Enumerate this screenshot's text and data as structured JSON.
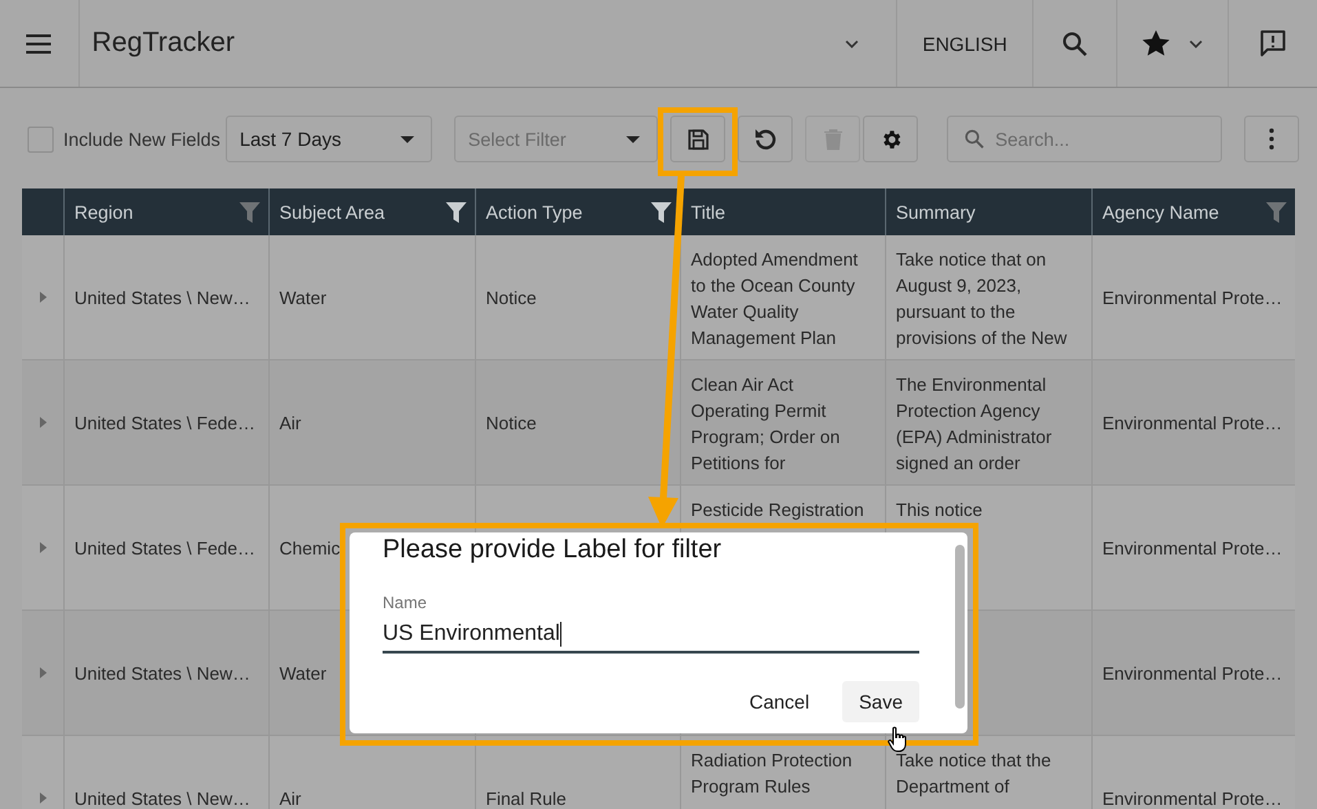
{
  "app": {
    "title": "RegTracker",
    "language": "ENGLISH"
  },
  "toolbar": {
    "include_new_fields": {
      "label": "Include New Fields",
      "checked": false
    },
    "date_range": "Last 7 Days",
    "filter": {
      "placeholder": "Select Filter"
    },
    "delete_button": {
      "disabled": true
    },
    "search": {
      "placeholder": "Search..."
    }
  },
  "table": {
    "columns": [
      {
        "label": "Region",
        "filter": true,
        "filter_active": false
      },
      {
        "label": "Subject Area",
        "filter": true,
        "filter_active": true
      },
      {
        "label": "Action Type",
        "filter": true,
        "filter_active": true
      },
      {
        "label": "Title",
        "filter": false
      },
      {
        "label": "Summary",
        "filter": false
      },
      {
        "label": "Agency Name",
        "filter": true,
        "filter_active": false
      }
    ],
    "rows": [
      {
        "region": "United States \\ New…",
        "subject_area": "Water",
        "action_type": "Notice",
        "title": "Adopted Amendment to the Ocean County Water Quality Management Plan",
        "summary": "Take notice that on August 9, 2023, pursuant to the provisions of the New",
        "agency_name": "Environmental Prote…"
      },
      {
        "region": "United States \\ Fede…",
        "subject_area": "Air",
        "action_type": "Notice",
        "title": "Clean Air Act Operating Permit Program; Order on Petitions for",
        "summary": "The Environmental Protection Agency (EPA) Administrator signed an order",
        "agency_name": "Environmental Prote…"
      },
      {
        "region": "United States \\ Fede…",
        "subject_area": "Chemic",
        "title": "Pesticide Registration",
        "summary": "This notice",
        "agency_name": "Environmental Prote…"
      },
      {
        "region": "United States \\ New…",
        "subject_area": "Water",
        "agency_name": "Environmental Prote…"
      },
      {
        "region": "United States \\ New…",
        "subject_area": "Air",
        "action_type": "Final Rule",
        "title": "Radiation Protection Program Rules",
        "summary": "Take notice that the Department of",
        "agency_name": "Environmental Prote…"
      }
    ]
  },
  "dialog": {
    "title": "Please provide Label for filter",
    "field_label": "Name",
    "value": "US Environmental",
    "buttons": [
      {
        "label": "Cancel",
        "hovered": false
      },
      {
        "label": "Save",
        "hovered": true
      }
    ]
  }
}
